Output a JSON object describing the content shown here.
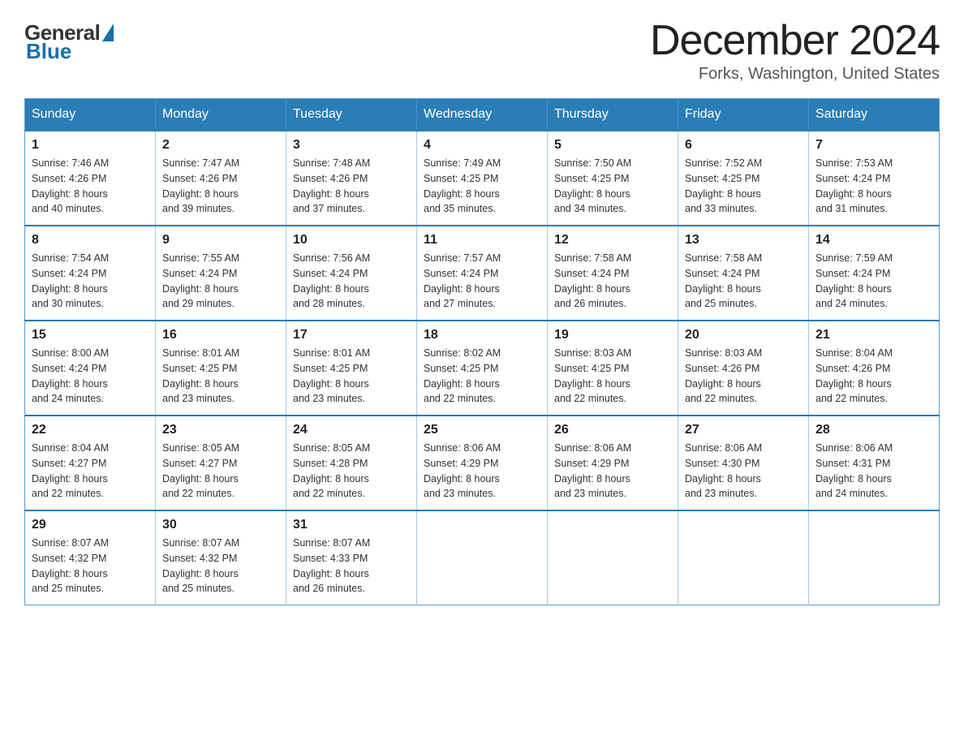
{
  "logo": {
    "general": "General",
    "blue": "Blue"
  },
  "header": {
    "month_year": "December 2024",
    "location": "Forks, Washington, United States"
  },
  "days_of_week": [
    "Sunday",
    "Monday",
    "Tuesday",
    "Wednesday",
    "Thursday",
    "Friday",
    "Saturday"
  ],
  "weeks": [
    [
      {
        "day": "1",
        "sunrise": "7:46 AM",
        "sunset": "4:26 PM",
        "daylight": "8 hours and 40 minutes."
      },
      {
        "day": "2",
        "sunrise": "7:47 AM",
        "sunset": "4:26 PM",
        "daylight": "8 hours and 39 minutes."
      },
      {
        "day": "3",
        "sunrise": "7:48 AM",
        "sunset": "4:26 PM",
        "daylight": "8 hours and 37 minutes."
      },
      {
        "day": "4",
        "sunrise": "7:49 AM",
        "sunset": "4:25 PM",
        "daylight": "8 hours and 35 minutes."
      },
      {
        "day": "5",
        "sunrise": "7:50 AM",
        "sunset": "4:25 PM",
        "daylight": "8 hours and 34 minutes."
      },
      {
        "day": "6",
        "sunrise": "7:52 AM",
        "sunset": "4:25 PM",
        "daylight": "8 hours and 33 minutes."
      },
      {
        "day": "7",
        "sunrise": "7:53 AM",
        "sunset": "4:24 PM",
        "daylight": "8 hours and 31 minutes."
      }
    ],
    [
      {
        "day": "8",
        "sunrise": "7:54 AM",
        "sunset": "4:24 PM",
        "daylight": "8 hours and 30 minutes."
      },
      {
        "day": "9",
        "sunrise": "7:55 AM",
        "sunset": "4:24 PM",
        "daylight": "8 hours and 29 minutes."
      },
      {
        "day": "10",
        "sunrise": "7:56 AM",
        "sunset": "4:24 PM",
        "daylight": "8 hours and 28 minutes."
      },
      {
        "day": "11",
        "sunrise": "7:57 AM",
        "sunset": "4:24 PM",
        "daylight": "8 hours and 27 minutes."
      },
      {
        "day": "12",
        "sunrise": "7:58 AM",
        "sunset": "4:24 PM",
        "daylight": "8 hours and 26 minutes."
      },
      {
        "day": "13",
        "sunrise": "7:58 AM",
        "sunset": "4:24 PM",
        "daylight": "8 hours and 25 minutes."
      },
      {
        "day": "14",
        "sunrise": "7:59 AM",
        "sunset": "4:24 PM",
        "daylight": "8 hours and 24 minutes."
      }
    ],
    [
      {
        "day": "15",
        "sunrise": "8:00 AM",
        "sunset": "4:24 PM",
        "daylight": "8 hours and 24 minutes."
      },
      {
        "day": "16",
        "sunrise": "8:01 AM",
        "sunset": "4:25 PM",
        "daylight": "8 hours and 23 minutes."
      },
      {
        "day": "17",
        "sunrise": "8:01 AM",
        "sunset": "4:25 PM",
        "daylight": "8 hours and 23 minutes."
      },
      {
        "day": "18",
        "sunrise": "8:02 AM",
        "sunset": "4:25 PM",
        "daylight": "8 hours and 22 minutes."
      },
      {
        "day": "19",
        "sunrise": "8:03 AM",
        "sunset": "4:25 PM",
        "daylight": "8 hours and 22 minutes."
      },
      {
        "day": "20",
        "sunrise": "8:03 AM",
        "sunset": "4:26 PM",
        "daylight": "8 hours and 22 minutes."
      },
      {
        "day": "21",
        "sunrise": "8:04 AM",
        "sunset": "4:26 PM",
        "daylight": "8 hours and 22 minutes."
      }
    ],
    [
      {
        "day": "22",
        "sunrise": "8:04 AM",
        "sunset": "4:27 PM",
        "daylight": "8 hours and 22 minutes."
      },
      {
        "day": "23",
        "sunrise": "8:05 AM",
        "sunset": "4:27 PM",
        "daylight": "8 hours and 22 minutes."
      },
      {
        "day": "24",
        "sunrise": "8:05 AM",
        "sunset": "4:28 PM",
        "daylight": "8 hours and 22 minutes."
      },
      {
        "day": "25",
        "sunrise": "8:06 AM",
        "sunset": "4:29 PM",
        "daylight": "8 hours and 23 minutes."
      },
      {
        "day": "26",
        "sunrise": "8:06 AM",
        "sunset": "4:29 PM",
        "daylight": "8 hours and 23 minutes."
      },
      {
        "day": "27",
        "sunrise": "8:06 AM",
        "sunset": "4:30 PM",
        "daylight": "8 hours and 23 minutes."
      },
      {
        "day": "28",
        "sunrise": "8:06 AM",
        "sunset": "4:31 PM",
        "daylight": "8 hours and 24 minutes."
      }
    ],
    [
      {
        "day": "29",
        "sunrise": "8:07 AM",
        "sunset": "4:32 PM",
        "daylight": "8 hours and 25 minutes."
      },
      {
        "day": "30",
        "sunrise": "8:07 AM",
        "sunset": "4:32 PM",
        "daylight": "8 hours and 25 minutes."
      },
      {
        "day": "31",
        "sunrise": "8:07 AM",
        "sunset": "4:33 PM",
        "daylight": "8 hours and 26 minutes."
      },
      null,
      null,
      null,
      null
    ]
  ],
  "labels": {
    "sunrise": "Sunrise:",
    "sunset": "Sunset:",
    "daylight": "Daylight:"
  }
}
